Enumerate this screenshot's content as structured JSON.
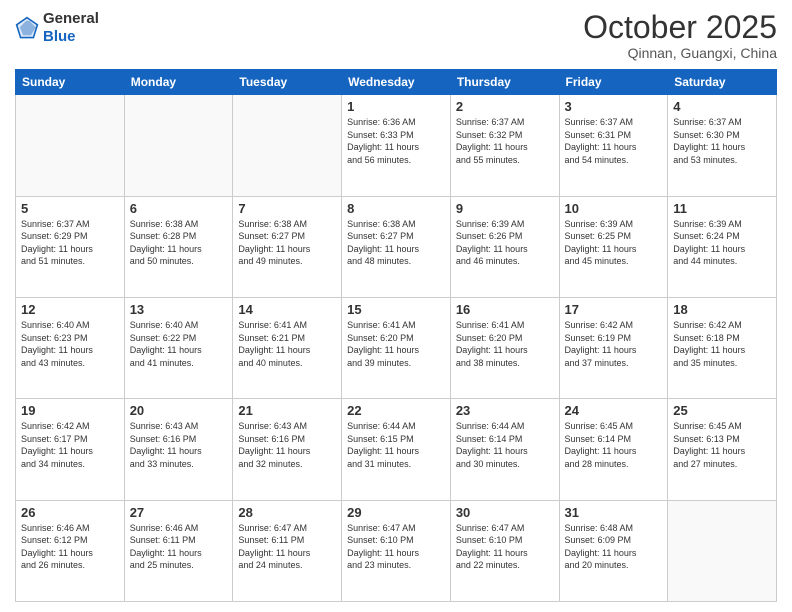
{
  "header": {
    "logo_general": "General",
    "logo_blue": "Blue",
    "title": "October 2025",
    "subtitle": "Qinnan, Guangxi, China"
  },
  "weekdays": [
    "Sunday",
    "Monday",
    "Tuesday",
    "Wednesday",
    "Thursday",
    "Friday",
    "Saturday"
  ],
  "weeks": [
    [
      {
        "day": "",
        "info": ""
      },
      {
        "day": "",
        "info": ""
      },
      {
        "day": "",
        "info": ""
      },
      {
        "day": "1",
        "info": "Sunrise: 6:36 AM\nSunset: 6:33 PM\nDaylight: 11 hours\nand 56 minutes."
      },
      {
        "day": "2",
        "info": "Sunrise: 6:37 AM\nSunset: 6:32 PM\nDaylight: 11 hours\nand 55 minutes."
      },
      {
        "day": "3",
        "info": "Sunrise: 6:37 AM\nSunset: 6:31 PM\nDaylight: 11 hours\nand 54 minutes."
      },
      {
        "day": "4",
        "info": "Sunrise: 6:37 AM\nSunset: 6:30 PM\nDaylight: 11 hours\nand 53 minutes."
      }
    ],
    [
      {
        "day": "5",
        "info": "Sunrise: 6:37 AM\nSunset: 6:29 PM\nDaylight: 11 hours\nand 51 minutes."
      },
      {
        "day": "6",
        "info": "Sunrise: 6:38 AM\nSunset: 6:28 PM\nDaylight: 11 hours\nand 50 minutes."
      },
      {
        "day": "7",
        "info": "Sunrise: 6:38 AM\nSunset: 6:27 PM\nDaylight: 11 hours\nand 49 minutes."
      },
      {
        "day": "8",
        "info": "Sunrise: 6:38 AM\nSunset: 6:27 PM\nDaylight: 11 hours\nand 48 minutes."
      },
      {
        "day": "9",
        "info": "Sunrise: 6:39 AM\nSunset: 6:26 PM\nDaylight: 11 hours\nand 46 minutes."
      },
      {
        "day": "10",
        "info": "Sunrise: 6:39 AM\nSunset: 6:25 PM\nDaylight: 11 hours\nand 45 minutes."
      },
      {
        "day": "11",
        "info": "Sunrise: 6:39 AM\nSunset: 6:24 PM\nDaylight: 11 hours\nand 44 minutes."
      }
    ],
    [
      {
        "day": "12",
        "info": "Sunrise: 6:40 AM\nSunset: 6:23 PM\nDaylight: 11 hours\nand 43 minutes."
      },
      {
        "day": "13",
        "info": "Sunrise: 6:40 AM\nSunset: 6:22 PM\nDaylight: 11 hours\nand 41 minutes."
      },
      {
        "day": "14",
        "info": "Sunrise: 6:41 AM\nSunset: 6:21 PM\nDaylight: 11 hours\nand 40 minutes."
      },
      {
        "day": "15",
        "info": "Sunrise: 6:41 AM\nSunset: 6:20 PM\nDaylight: 11 hours\nand 39 minutes."
      },
      {
        "day": "16",
        "info": "Sunrise: 6:41 AM\nSunset: 6:20 PM\nDaylight: 11 hours\nand 38 minutes."
      },
      {
        "day": "17",
        "info": "Sunrise: 6:42 AM\nSunset: 6:19 PM\nDaylight: 11 hours\nand 37 minutes."
      },
      {
        "day": "18",
        "info": "Sunrise: 6:42 AM\nSunset: 6:18 PM\nDaylight: 11 hours\nand 35 minutes."
      }
    ],
    [
      {
        "day": "19",
        "info": "Sunrise: 6:42 AM\nSunset: 6:17 PM\nDaylight: 11 hours\nand 34 minutes."
      },
      {
        "day": "20",
        "info": "Sunrise: 6:43 AM\nSunset: 6:16 PM\nDaylight: 11 hours\nand 33 minutes."
      },
      {
        "day": "21",
        "info": "Sunrise: 6:43 AM\nSunset: 6:16 PM\nDaylight: 11 hours\nand 32 minutes."
      },
      {
        "day": "22",
        "info": "Sunrise: 6:44 AM\nSunset: 6:15 PM\nDaylight: 11 hours\nand 31 minutes."
      },
      {
        "day": "23",
        "info": "Sunrise: 6:44 AM\nSunset: 6:14 PM\nDaylight: 11 hours\nand 30 minutes."
      },
      {
        "day": "24",
        "info": "Sunrise: 6:45 AM\nSunset: 6:14 PM\nDaylight: 11 hours\nand 28 minutes."
      },
      {
        "day": "25",
        "info": "Sunrise: 6:45 AM\nSunset: 6:13 PM\nDaylight: 11 hours\nand 27 minutes."
      }
    ],
    [
      {
        "day": "26",
        "info": "Sunrise: 6:46 AM\nSunset: 6:12 PM\nDaylight: 11 hours\nand 26 minutes."
      },
      {
        "day": "27",
        "info": "Sunrise: 6:46 AM\nSunset: 6:11 PM\nDaylight: 11 hours\nand 25 minutes."
      },
      {
        "day": "28",
        "info": "Sunrise: 6:47 AM\nSunset: 6:11 PM\nDaylight: 11 hours\nand 24 minutes."
      },
      {
        "day": "29",
        "info": "Sunrise: 6:47 AM\nSunset: 6:10 PM\nDaylight: 11 hours\nand 23 minutes."
      },
      {
        "day": "30",
        "info": "Sunrise: 6:47 AM\nSunset: 6:10 PM\nDaylight: 11 hours\nand 22 minutes."
      },
      {
        "day": "31",
        "info": "Sunrise: 6:48 AM\nSunset: 6:09 PM\nDaylight: 11 hours\nand 20 minutes."
      },
      {
        "day": "",
        "info": ""
      }
    ]
  ]
}
